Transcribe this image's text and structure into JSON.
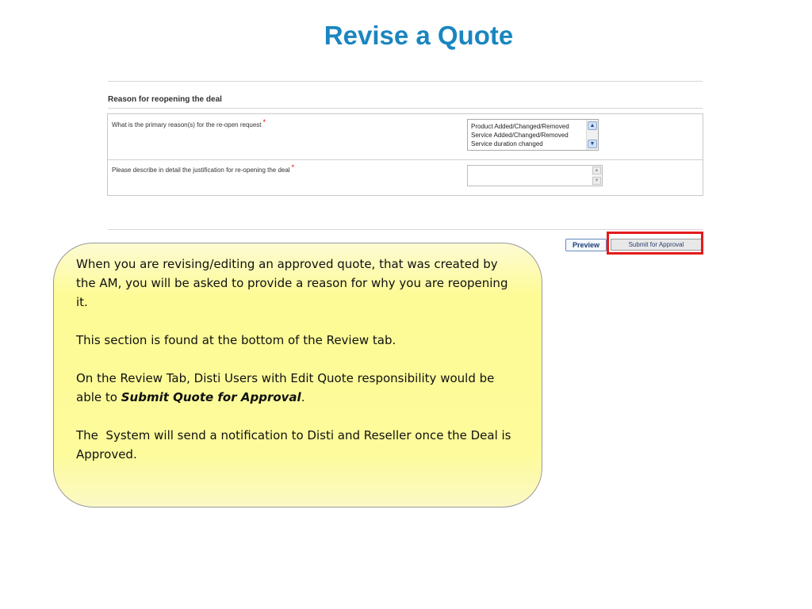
{
  "slide": {
    "title": "Revise a Quote"
  },
  "form": {
    "section_title": "Reason for reopening the deal",
    "question1": "What is the primary reason(s) for the re-open request",
    "question2": "Please describe in detail the justification for re-opening the deal",
    "required_marker": "*",
    "reason_options": [
      "Product Added/Changed/Removed",
      "Service Added/Changed/Removed",
      "Service duration changed"
    ],
    "justification_value": ""
  },
  "buttons": {
    "preview": "Preview",
    "submit": "Submit for Approval"
  },
  "callout": {
    "para1": "When you are revising/editing an approved quote, that was created by the AM, you will be asked to provide a reason for why you are reopening it.",
    "para2": "This section is found at the bottom of the Review tab.",
    "para3_prefix": "On the Review Tab, Disti Users with Edit Quote responsibility would be able to ",
    "para3_emphasis": "Submit Quote for Approval",
    "para3_suffix": ".",
    "para4": "The  System will send a notification to Disti and Reseller once the Deal is Approved."
  },
  "colors": {
    "title": "#1a86c0",
    "highlight": "#e31b1b",
    "callout_fill": "#fdfb95"
  },
  "icons": {
    "scroll_up": "chevron-up-icon",
    "scroll_down": "chevron-down-icon"
  }
}
